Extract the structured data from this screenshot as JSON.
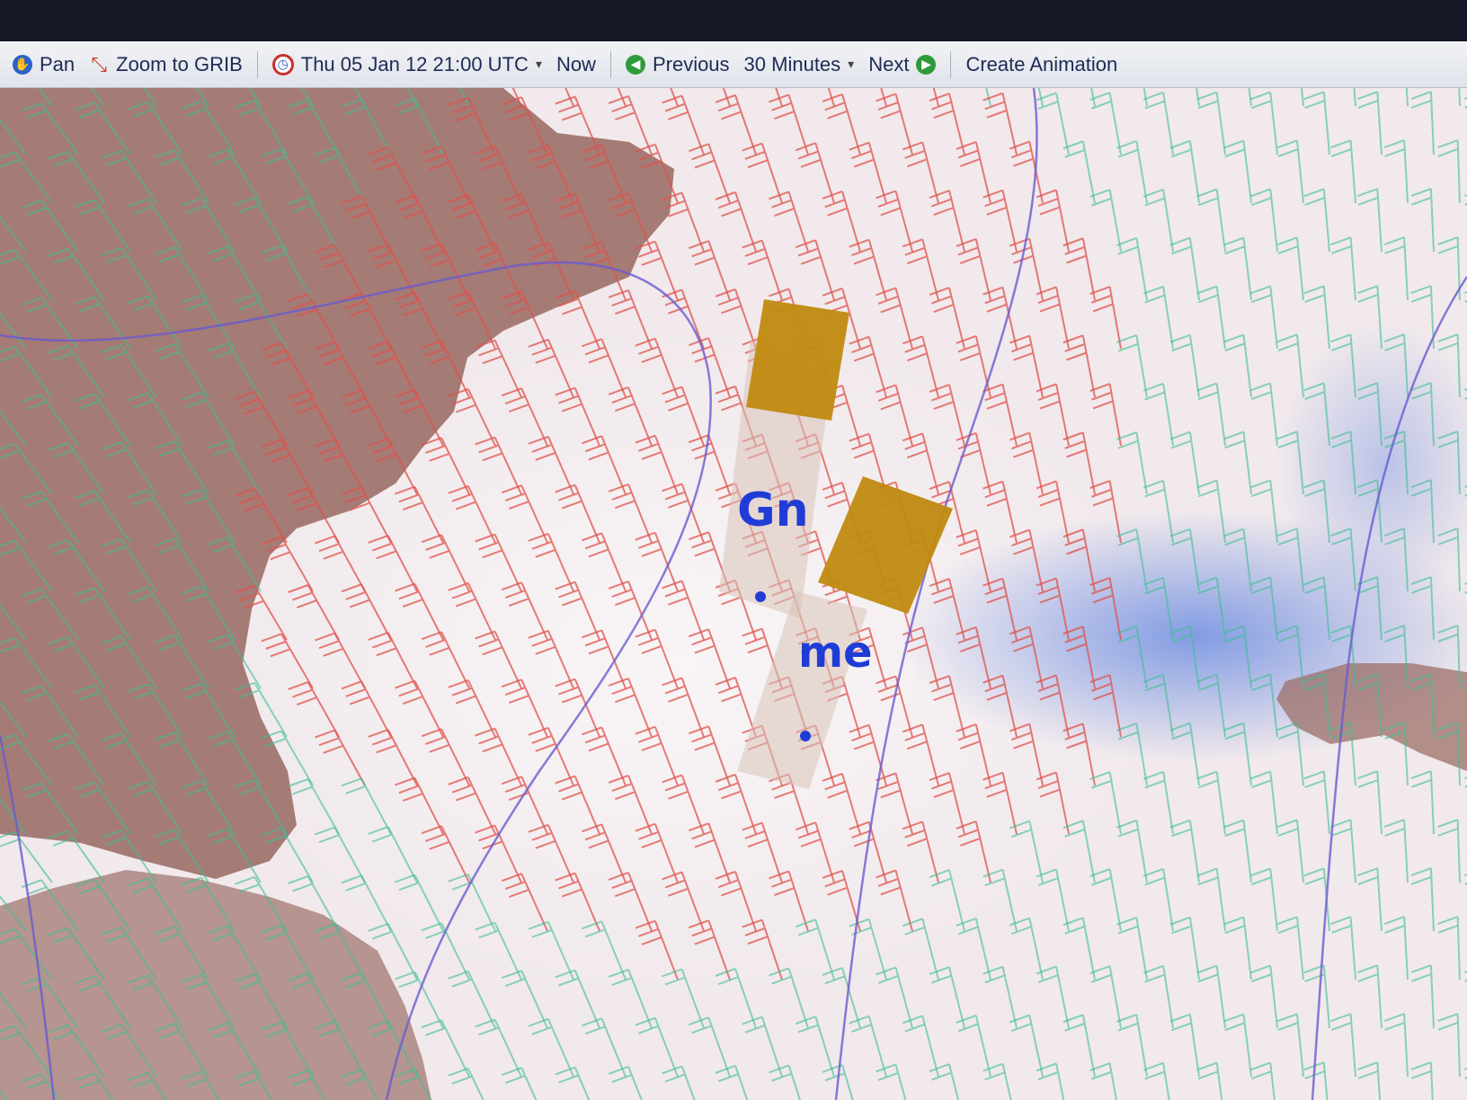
{
  "toolbar": {
    "pan": "Pan",
    "zoom": "Zoom to GRIB",
    "date": "Thu 05 Jan 12 21:00 UTC",
    "now": "Now",
    "previous": "Previous",
    "step": "30 Minutes",
    "next": "Next",
    "animation": "Create Animation"
  },
  "map": {
    "labels": {
      "group": "Gn",
      "me": "me"
    },
    "colors": {
      "land": "#9c6f68",
      "sea": "#f1e9ec",
      "wind_strong": "#e0524c",
      "wind_moderate": "#3fbf93",
      "isobar": "#6a5bd0",
      "storm_box": "#c08a10",
      "cold_area": "#7d9be6"
    }
  }
}
